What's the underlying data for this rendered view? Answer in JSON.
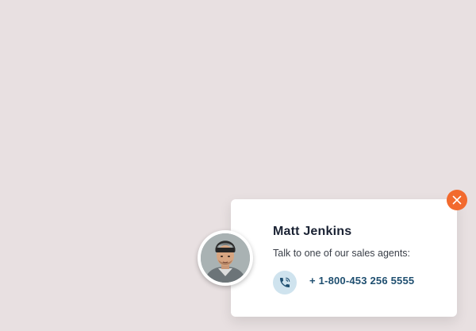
{
  "contact_card": {
    "name": "Matt Jenkins",
    "subtitle": "Talk to one of our sales agents:",
    "phone": "+ 1-800-453 256 5555"
  },
  "icons": {
    "close": "close-icon",
    "phone": "phone-icon",
    "avatar": "avatar"
  },
  "colors": {
    "background": "#e8e0e1",
    "close_button": "#f26a2e",
    "phone_text": "#1f4f70",
    "phone_icon_bg": "#cfe3ee",
    "name_text": "#1a2233"
  }
}
